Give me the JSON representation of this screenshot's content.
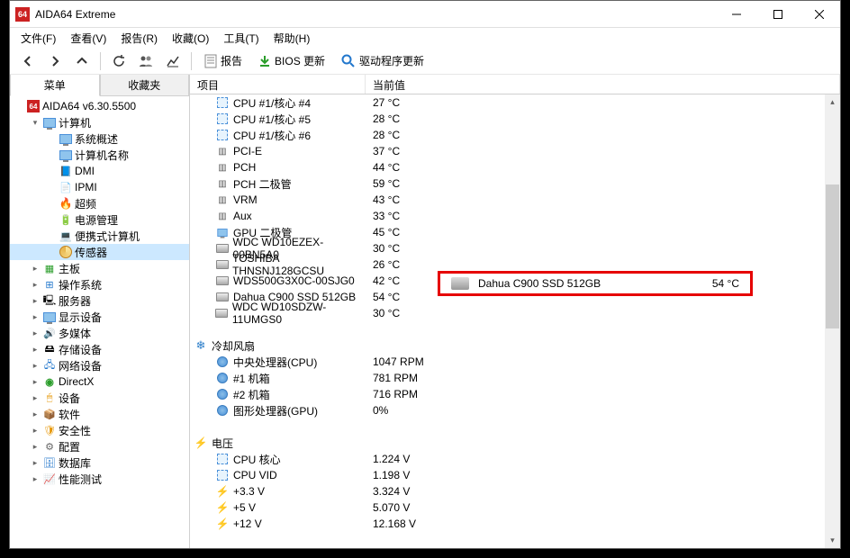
{
  "titlebar": {
    "app_badge": "64",
    "title": "AIDA64 Extreme"
  },
  "menubar": [
    "文件(F)",
    "查看(V)",
    "报告(R)",
    "收藏(O)",
    "工具(T)",
    "帮助(H)"
  ],
  "toolbar_actions": {
    "report": "报告",
    "bios": "BIOS 更新",
    "driver": "驱动程序更新"
  },
  "side_tabs": {
    "menu": "菜单",
    "favorites": "收藏夹"
  },
  "tree": [
    {
      "label": "AIDA64 v6.30.5500",
      "depth": 0,
      "icon": "app",
      "caret": ""
    },
    {
      "label": "计算机",
      "depth": 1,
      "icon": "mon",
      "caret": "▾"
    },
    {
      "label": "系统概述",
      "depth": 2,
      "icon": "mon",
      "caret": ""
    },
    {
      "label": "计算机名称",
      "depth": 2,
      "icon": "mon",
      "caret": ""
    },
    {
      "label": "DMI",
      "depth": 2,
      "icon": "dmi",
      "caret": ""
    },
    {
      "label": "IPMI",
      "depth": 2,
      "icon": "ipmi",
      "caret": ""
    },
    {
      "label": "超频",
      "depth": 2,
      "icon": "oc",
      "caret": ""
    },
    {
      "label": "电源管理",
      "depth": 2,
      "icon": "power",
      "caret": ""
    },
    {
      "label": "便携式计算机",
      "depth": 2,
      "icon": "laptop",
      "caret": ""
    },
    {
      "label": "传感器",
      "depth": 2,
      "icon": "gauge",
      "caret": "",
      "selected": true
    },
    {
      "label": "主板",
      "depth": 1,
      "icon": "mb",
      "caret": "▸"
    },
    {
      "label": "操作系统",
      "depth": 1,
      "icon": "os",
      "caret": "▸"
    },
    {
      "label": "服务器",
      "depth": 1,
      "icon": "srv",
      "caret": "▸"
    },
    {
      "label": "显示设备",
      "depth": 1,
      "icon": "mon",
      "caret": "▸"
    },
    {
      "label": "多媒体",
      "depth": 1,
      "icon": "mm",
      "caret": "▸"
    },
    {
      "label": "存储设备",
      "depth": 1,
      "icon": "stor",
      "caret": "▸"
    },
    {
      "label": "网络设备",
      "depth": 1,
      "icon": "net",
      "caret": "▸"
    },
    {
      "label": "DirectX",
      "depth": 1,
      "icon": "dx",
      "caret": "▸"
    },
    {
      "label": "设备",
      "depth": 1,
      "icon": "dev",
      "caret": "▸"
    },
    {
      "label": "软件",
      "depth": 1,
      "icon": "sw",
      "caret": "▸"
    },
    {
      "label": "安全性",
      "depth": 1,
      "icon": "sec",
      "caret": "▸"
    },
    {
      "label": "配置",
      "depth": 1,
      "icon": "cfg",
      "caret": "▸"
    },
    {
      "label": "数据库",
      "depth": 1,
      "icon": "db",
      "caret": "▸"
    },
    {
      "label": "性能测试",
      "depth": 1,
      "icon": "bench",
      "caret": "▸"
    }
  ],
  "columns": {
    "item": "项目",
    "value": "当前值"
  },
  "rows": [
    {
      "icon": "chip",
      "label": "CPU #1/核心 #4",
      "value": "27 °C"
    },
    {
      "icon": "chip",
      "label": "CPU #1/核心 #5",
      "value": "28 °C"
    },
    {
      "icon": "chip",
      "label": "CPU #1/核心 #6",
      "value": "28 °C"
    },
    {
      "icon": "pcie",
      "label": "PCI-E",
      "value": "37 °C"
    },
    {
      "icon": "pch",
      "label": "PCH",
      "value": "44 °C"
    },
    {
      "icon": "pch",
      "label": "PCH 二极管",
      "value": "59 °C"
    },
    {
      "icon": "vrm",
      "label": "VRM",
      "value": "43 °C"
    },
    {
      "icon": "aux",
      "label": "Aux",
      "value": "33 °C"
    },
    {
      "icon": "gpu",
      "label": "GPU 二极管",
      "value": "45 °C"
    },
    {
      "icon": "disk",
      "label": "WDC WD10EZEX-00BN5A0",
      "value": "30 °C"
    },
    {
      "icon": "disk",
      "label": "TOSHIBA THNSNJ128GCSU",
      "value": "26 °C"
    },
    {
      "icon": "disk",
      "label": "WDS500G3X0C-00SJG0",
      "value": "42 °C"
    },
    {
      "icon": "disk",
      "label": "Dahua C900 SSD 512GB",
      "value": "54 °C"
    },
    {
      "icon": "disk",
      "label": "WDC WD10SDZW-11UMGS0",
      "value": "30 °C"
    },
    {
      "section": true
    },
    {
      "icon": "fanhdr",
      "label": "冷却风扇",
      "section": true
    },
    {
      "icon": "fan",
      "label": "中央处理器(CPU)",
      "value": "1047 RPM"
    },
    {
      "icon": "fan",
      "label": "#1 机箱",
      "value": "781 RPM"
    },
    {
      "icon": "fan",
      "label": "#2 机箱",
      "value": "716 RPM"
    },
    {
      "icon": "fan",
      "label": "图形处理器(GPU)",
      "value": "0%"
    },
    {
      "section": true
    },
    {
      "icon": "bolthdr",
      "label": "电压",
      "section": true
    },
    {
      "icon": "chip",
      "label": "CPU 核心",
      "value": "1.224 V"
    },
    {
      "icon": "chip",
      "label": "CPU VID",
      "value": "1.198 V"
    },
    {
      "icon": "bolt",
      "label": "+3.3 V",
      "value": "3.324 V"
    },
    {
      "icon": "bolt",
      "label": "+5 V",
      "value": "5.070 V"
    },
    {
      "icon": "bolt",
      "label": "+12 V",
      "value": "12.168 V"
    }
  ],
  "callout": {
    "label": "Dahua C900 SSD 512GB",
    "value": "54 °C"
  }
}
